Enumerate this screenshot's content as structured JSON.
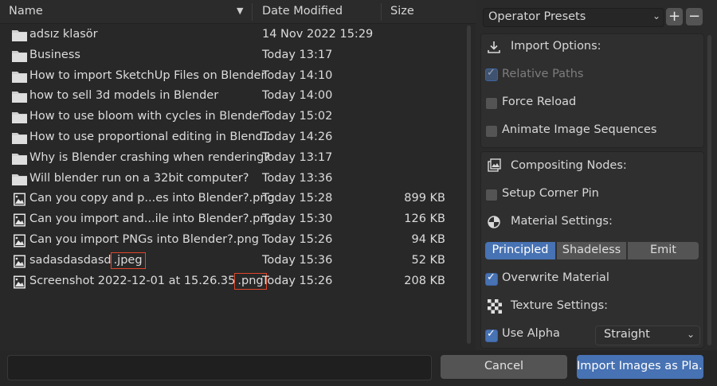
{
  "file_list": {
    "columns": {
      "name": "Name",
      "date": "Date Modified",
      "size": "Size"
    },
    "rows": [
      {
        "type": "folder",
        "name": "adsız klasör",
        "date": "14 Nov 2022 15:29",
        "size": ""
      },
      {
        "type": "folder",
        "name": "Business",
        "date": "Today 13:17",
        "size": ""
      },
      {
        "type": "folder",
        "name": "How to import SketchUp Files on Blender",
        "date": "Today 14:10",
        "size": ""
      },
      {
        "type": "folder",
        "name": "how to sell 3d models in Blender",
        "date": "Today 14:00",
        "size": ""
      },
      {
        "type": "folder",
        "name": "How to use bloom with cycles in Blender",
        "date": "Today 15:02",
        "size": ""
      },
      {
        "type": "folder",
        "name": "How to use proportional editing in Blend...",
        "date": "Today 14:26",
        "size": ""
      },
      {
        "type": "folder",
        "name": "Why is Blender crashing when rendering?",
        "date": "Today 13:17",
        "size": ""
      },
      {
        "type": "folder",
        "name": "Will blender run on a 32bit computer?",
        "date": "Today 13:36",
        "size": ""
      },
      {
        "type": "image",
        "name": "Can you copy and p...es into Blender?.png",
        "date": "Today 15:28",
        "size": "899 KB"
      },
      {
        "type": "image",
        "name": "Can you import and...ile into Blender?.png",
        "date": "Today 15:30",
        "size": "126 KB"
      },
      {
        "type": "image",
        "name": "Can you import PNGs into Blender?.png",
        "date": "Today 15:26",
        "size": "94 KB"
      },
      {
        "type": "image",
        "name_base": "sadasdasdasd",
        "name_ext": ".jpeg",
        "date": "Today 15:36",
        "size": "52 KB"
      },
      {
        "type": "image",
        "name_base": "Screenshot 2022-12-01 at 15.26.35",
        "name_ext": ".png",
        "date": "Today 15:26",
        "size": "208 KB"
      }
    ]
  },
  "options": {
    "presets_label": "Operator Presets",
    "presets_add": "+",
    "presets_remove": "−",
    "import_options_label": "Import Options:",
    "relative_paths": "Relative Paths",
    "force_reload": "Force Reload",
    "animate_sequences": "Animate Image Sequences",
    "compositing_label": "Compositing Nodes:",
    "setup_corner_pin": "Setup Corner Pin",
    "material_settings_label": "Material Settings:",
    "shader_options": [
      "Principled",
      "Shadeless",
      "Emit"
    ],
    "shader_selected": "Principled",
    "overwrite_material": "Overwrite Material",
    "texture_settings_label": "Texture Settings:",
    "use_alpha": "Use Alpha",
    "alpha_mode": "Straight"
  },
  "footer": {
    "filename_value": "",
    "cancel_label": "Cancel",
    "import_label": "Import Images as Pla..."
  },
  "colors": {
    "accent": "#4772b3",
    "highlight_box": "#e0462a",
    "background": "#303030"
  }
}
